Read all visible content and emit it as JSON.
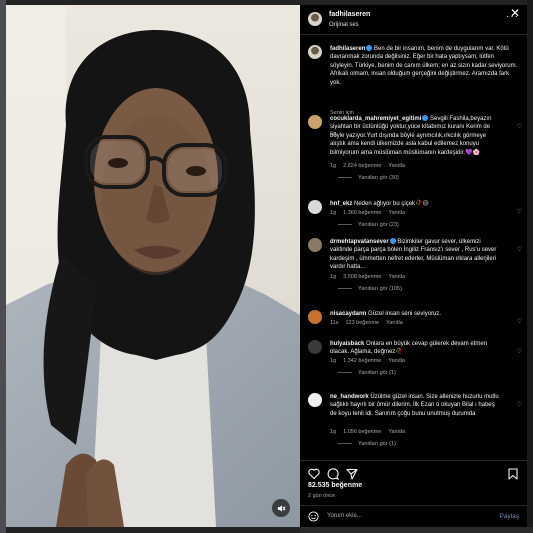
{
  "post": {
    "username": "fadhilaseren",
    "audio": "Orijinal ses",
    "caption_user": "fadhilaseren",
    "caption_text": "Ben de bir insanım, benim de duygularım var. Kötü davranmak zorunda değilsiniz. Eğer bir hata yaptıysam, lütfen söyleyin. Türkiye, benim de canım ülkem; en az sizin kadar seviyorum. Afrikalı olmam, insan olduğum gerçeğini değiştirmez. Aramızda fark yok.",
    "caption_time": "2g",
    "translate_label": "Senin için",
    "likes": "82.535 beğenme",
    "ago": "2 gün önce",
    "comment_placeholder": "Yorum ekle...",
    "post_button": "Paylaş"
  },
  "comments": [
    {
      "user": "cocuklarda_mahremiyet_egitimi",
      "verified": true,
      "text": "Sevgili Fashila,beyazın siyahtan bir üstünlüğü yoktur,yüce kitabımız kuranı Kerim de böyle yazıyor.Yurt dışında böyle ayrımcılık,ırkcılık görmeye alıştık ama kendi ülkemizde asla kabul edilemez konuyu bilmiyorum ama müslüman müslümanın kardeşidir.💜🌸",
      "time": "1g",
      "likes": "2.824 beğenme",
      "reply": "Yanıtla",
      "replies": "Yanıtları gör (30)",
      "avatar_color": "#c9a36a"
    },
    {
      "user": "hnf_ekz",
      "verified": false,
      "text": "Neden ağlıyor bu çiçek🥀😔",
      "time": "1g",
      "likes": "1.360 beğenme",
      "reply": "Yanıtla",
      "replies": "Yanıtları gör (23)",
      "avatar_color": "#d9d9d9"
    },
    {
      "user": "drmehtapvatansever",
      "verified": true,
      "text": "Bizimkiler gavur sever, ülkemizi vaktinde parça parça bölen İngiliz Fransız'ı sever , Rus'u sever kardeşim , ümmetten nefret ederler, Müslüman ırklara allerjileri vardır hatta...",
      "time": "1g",
      "likes": "3.508 beğenme",
      "reply": "Yanıtla",
      "replies": "Yanıtları gör (105)",
      "avatar_color": "#8a7a66"
    },
    {
      "user": "nisacaydann",
      "verified": false,
      "text": "Güzel insan seni seviyoruz.",
      "time": "11s",
      "likes": "123 beğenme",
      "reply": "Yanıtla",
      "replies": "",
      "avatar_color": "#c7732e"
    },
    {
      "user": "hulyaisback",
      "verified": false,
      "text": "Onlara en büyük cevap gülerek devam etmen olacak. Ağlama, değmez🥀",
      "time": "1g",
      "likes": "1.342 beğenme",
      "reply": "Yanıtla",
      "replies": "Yanıtları gör (1)",
      "avatar_color": "#3a3a3a"
    },
    {
      "user": "ne_handwork",
      "verified": false,
      "text": "Üzülme güzel insan. Size allenizle huzurlu mutlu sağlıklı hayırlı bir ömür dilerim. İlk Ezan o okuyan Bilal ı habeş de koyu tenli idi. Sanırım çoğu bunu unutmuş durumda",
      "time": "1g",
      "likes": "1.056 beğenme",
      "reply": "Yanıtla",
      "replies": "Yanıtları gör (1)",
      "avatar_color": "#f0f0f0"
    }
  ],
  "icons": {
    "more": "more-horizontal-icon",
    "close": "close-icon",
    "heart": "heart-icon",
    "comment": "comment-icon",
    "share": "share-icon",
    "save": "bookmark-icon",
    "emoji": "emoji-icon",
    "mute": "mute-icon"
  },
  "colors": {
    "link": "#3897f0",
    "panel_bg": "#000000",
    "muted_text": "#a8a8a8"
  }
}
